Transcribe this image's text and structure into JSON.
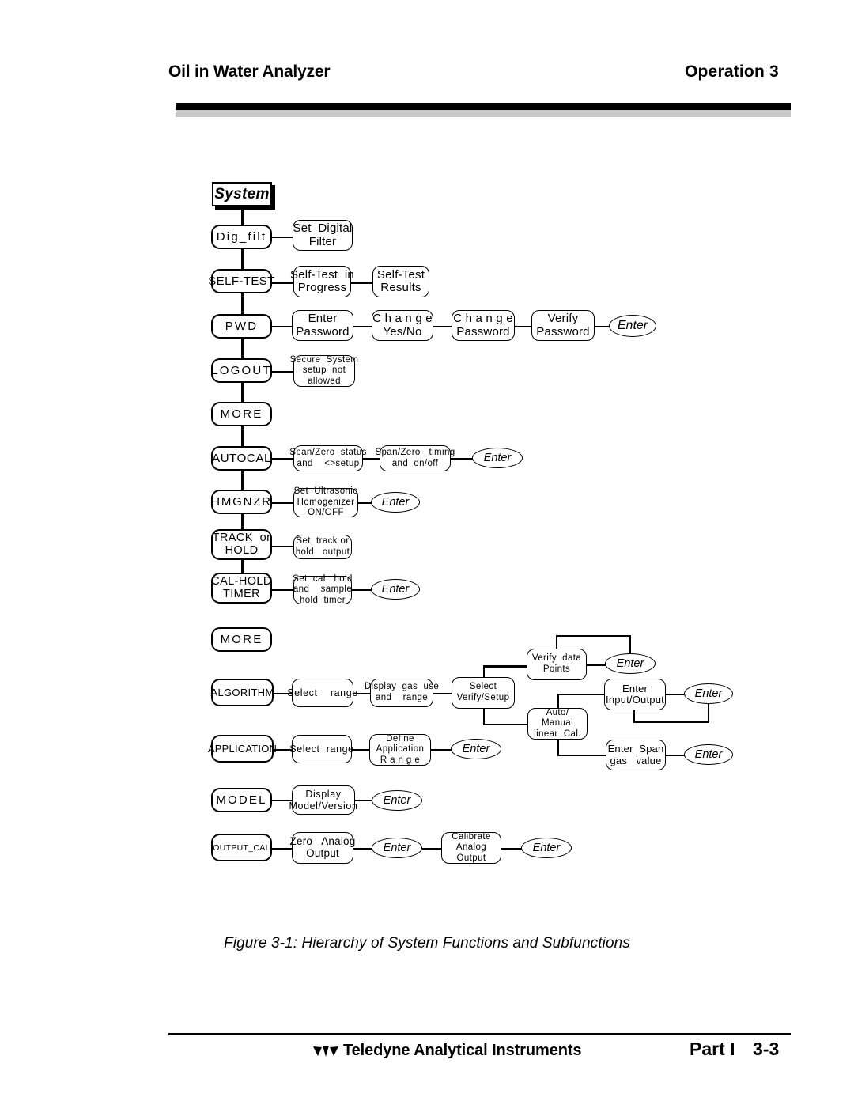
{
  "header": {
    "title_left": "Oil in Water Analyzer",
    "title_right": "Operation  3"
  },
  "figure": {
    "caption": "Figure 3-1:  Hierarchy of System Functions and Subfunctions",
    "root": "System",
    "enter_label": "Enter",
    "rows": [
      {
        "id": "dig-filt",
        "main": "Dig_filt",
        "subs": [
          "Set  Digital\nFilter"
        ]
      },
      {
        "id": "self-test",
        "main": "SELF-TEST",
        "subs": [
          "Self-Test  in\nProgress",
          "Self-Test\nResults"
        ]
      },
      {
        "id": "pwd",
        "main": "PWD",
        "subs": [
          "Enter\nPassword",
          "C h a n g e\nYes/No",
          "C h a n g e\nPassword",
          "Verify\nPassword"
        ],
        "enter": true
      },
      {
        "id": "logout",
        "main": "LOGOUT",
        "subs": [
          "Secure  System\nsetup  not\nallowed"
        ]
      },
      {
        "id": "more-1",
        "main": "MORE",
        "subs": []
      },
      {
        "id": "autocal",
        "main": "AUTOCAL",
        "subs": [
          "Span/Zero  status\nand    <>setup",
          "Span/Zero   timing\nand  on/off"
        ],
        "enter": true
      },
      {
        "id": "hmgnzr",
        "main": "HMGNZR",
        "subs": [
          "Set  Ultrasonic\nHomogenizer\nON/OFF"
        ],
        "enter": true
      },
      {
        "id": "track-hold",
        "main": "TRACK  or\nHOLD",
        "subs": [
          "Set  track or\nhold   output"
        ]
      },
      {
        "id": "cal-hold-timer",
        "main": "CAL-HOLD\nTIMER",
        "subs": [
          "Set  cal.  hold\nand    sample\nhold  timer"
        ],
        "enter": true
      },
      {
        "id": "more-2",
        "main": "MORE",
        "subs": []
      },
      {
        "id": "algorithm",
        "main": "ALGORITHM",
        "subs": [
          "Select    range",
          "Display  gas  use\nand    range",
          "Select\nVerify/Setup"
        ]
      },
      {
        "id": "application",
        "main": "APPLICATION",
        "subs": [
          "Select  range",
          "Define\nApplication\nR a n g e"
        ],
        "enter": true
      },
      {
        "id": "model",
        "main": "MODEL",
        "subs": [
          "Display\nModel/Version"
        ],
        "enter": true
      },
      {
        "id": "output-cal",
        "main": "OUTPUT_CAL",
        "subs": [
          "Zero   Analog\nOutput",
          "Calibrate\nAnalog\nOutput"
        ],
        "enter": true
      }
    ],
    "algorithm_branch": {
      "verify_data_points": "Verify  data\nPoints",
      "auto_manual_cal": "Auto/\nManual\nlinear  Cal.",
      "enter_input_output": "Enter\nInput/Output",
      "enter_span_gas": "Enter  Span\ngas   value"
    }
  },
  "footer": {
    "company": "Teledyne Analytical Instruments",
    "part": "Part I",
    "page": "3-3"
  }
}
